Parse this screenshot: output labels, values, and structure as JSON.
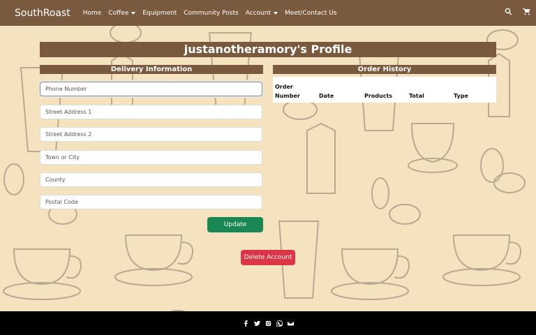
{
  "navbar": {
    "brand": "SouthRoast",
    "links": [
      {
        "label": "Home"
      },
      {
        "label": "Coffee"
      },
      {
        "label": "Equipment"
      },
      {
        "label": "Community Posts"
      },
      {
        "label": "Account"
      },
      {
        "label": "Meet/Contact Us"
      }
    ],
    "icons": [
      "search-icon",
      "cart-icon"
    ]
  },
  "profile": {
    "title": "justanotheramory's Profile"
  },
  "delivery": {
    "heading": "Delivery Information",
    "fields": {
      "phone": {
        "placeholder": "Phone Number"
      },
      "street1": {
        "placeholder": "Street Address 1"
      },
      "street2": {
        "placeholder": "Street Address 2"
      },
      "town": {
        "placeholder": "Town or City"
      },
      "county": {
        "placeholder": "County"
      },
      "postcode": {
        "placeholder": "Postal Code"
      }
    },
    "update_label": "Update"
  },
  "orders": {
    "heading": "Order History",
    "columns": {
      "order_line1": "Order",
      "order_line2": "Number",
      "date": "Date",
      "products": "Products",
      "total": "Total",
      "type": "Type"
    }
  },
  "account": {
    "delete_label": "Delete Account"
  },
  "footer": {
    "icons": [
      "facebook-icon",
      "twitter-icon",
      "instagram-icon",
      "whatsapp-icon",
      "email-icon"
    ]
  },
  "colors": {
    "navbar": "#7a5a3e",
    "background": "#f5e2bf",
    "update_button": "#198754",
    "delete_button": "#dc3545",
    "footer": "#000000"
  }
}
